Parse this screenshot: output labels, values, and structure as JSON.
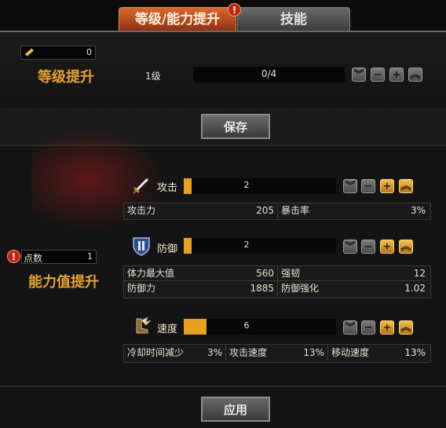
{
  "tabs": {
    "level_ability": "等级/能力提升",
    "skill": "技能",
    "alert": "!"
  },
  "level": {
    "item_count": "0",
    "title": "等级提升",
    "current_level": "1级",
    "progress_text": "0/4",
    "save_button": "保存"
  },
  "ability": {
    "points_label": "点数",
    "points_value": "1",
    "points_alert": "!",
    "title": "能力值提升",
    "apply_button": "应用"
  },
  "controls": {
    "double_down": "︾",
    "minus": "−",
    "plus": "+",
    "double_up": "︽"
  },
  "attack": {
    "label": "攻击",
    "value": "2",
    "fill": 0.05,
    "stats": [
      {
        "label": "攻击力",
        "value": "205"
      },
      {
        "label": "暴击率",
        "value": "3%"
      }
    ]
  },
  "defense": {
    "label": "防御",
    "value": "2",
    "fill": 0.05,
    "stats": [
      {
        "label": "体力最大值",
        "value": "560"
      },
      {
        "label": "强韧",
        "value": "12"
      },
      {
        "label": "防御力",
        "value": "1885"
      },
      {
        "label": "防御强化",
        "value": "1.02"
      }
    ]
  },
  "speed": {
    "label": "速度",
    "value": "6",
    "fill": 0.15,
    "stats": [
      {
        "label": "冷却时间减少",
        "value": "3%"
      },
      {
        "label": "攻击速度",
        "value": "13%"
      },
      {
        "label": "移动速度",
        "value": "13%"
      }
    ]
  },
  "icons": {
    "attack": "sword-icon",
    "defense": "shield-icon",
    "speed": "winged-boot-icon",
    "item": "scroll-icon"
  },
  "colors": {
    "accent_gold": "#e8a430",
    "tab_active": "#c4542a",
    "alert_red": "#c72010"
  }
}
